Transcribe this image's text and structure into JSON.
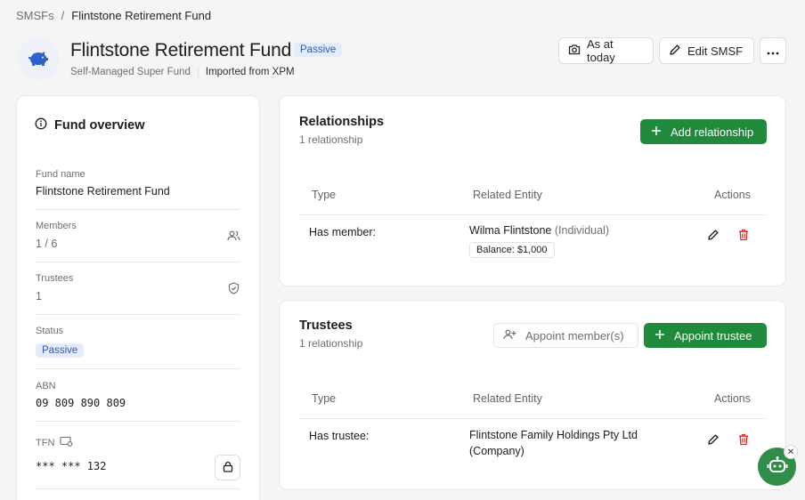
{
  "breadcrumb": {
    "root": "SMSFs",
    "separator": "/",
    "current": "Flintstone Retirement Fund"
  },
  "header": {
    "title": "Flintstone Retirement Fund",
    "status_badge": "Passive",
    "subtitle": "Self-Managed Super Fund",
    "imported": "Imported from XPM",
    "as_at_label": "As at today",
    "edit_label": "Edit SMSF",
    "more_icon": "more-horizontal-icon"
  },
  "overview": {
    "title": "Fund overview",
    "fund_name_label": "Fund name",
    "fund_name": "Flintstone Retirement Fund",
    "members_label": "Members",
    "members": "1 / 6",
    "trustees_label": "Trustees",
    "trustees": "1",
    "status_label": "Status",
    "status": "Passive",
    "abn_label": "ABN",
    "abn": "09 809 890 809",
    "tfn_label": "TFN",
    "tfn": "*** *** 132"
  },
  "relationships": {
    "title": "Relationships",
    "count": "1 relationship",
    "add_label": "Add relationship",
    "columns": [
      "Type",
      "Related Entity",
      "Actions"
    ],
    "rows": [
      {
        "type": "Has member:",
        "entity": "Wilma Flintstone",
        "entity_kind": "(Individual)",
        "balance": "Balance: $1,000"
      }
    ]
  },
  "trustees": {
    "title": "Trustees",
    "count": "1 relationship",
    "appoint_member_label": "Appoint member(s)",
    "appoint_trustee_label": "Appoint trustee",
    "columns": [
      "Type",
      "Related Entity",
      "Actions"
    ],
    "rows": [
      {
        "type": "Has trustee:",
        "entity": "Flintstone Family Holdings Pty Ltd",
        "entity_kind": "(Company)"
      }
    ]
  },
  "colors": {
    "accent_green": "#1f8a3b",
    "badge_blue": "#2f56b4",
    "delete_red": "#d92d20"
  }
}
